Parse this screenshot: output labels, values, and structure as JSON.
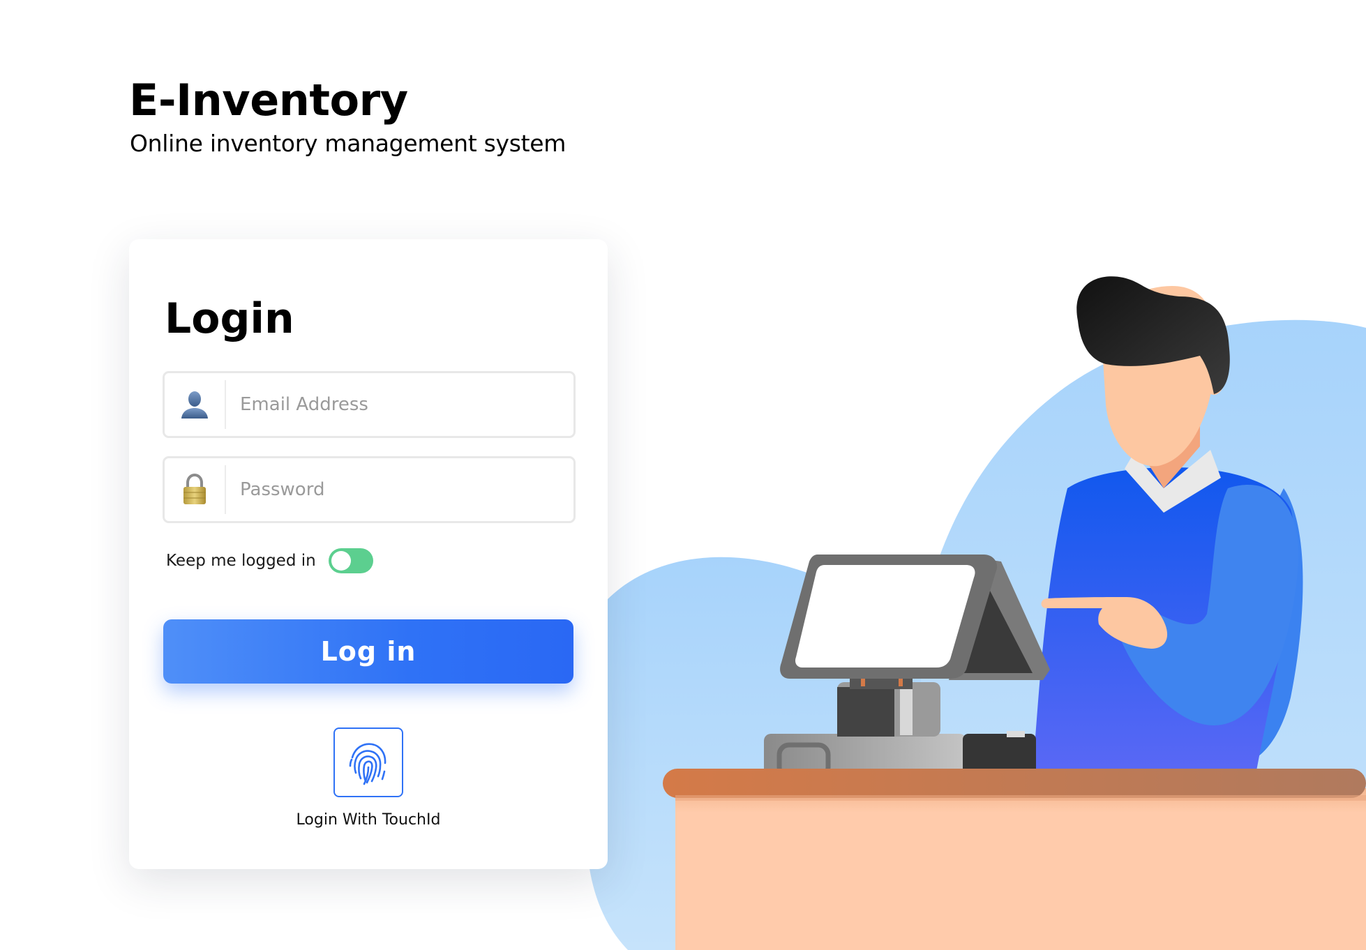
{
  "brand": {
    "title": "E-Inventory",
    "subtitle": "Online inventory management system"
  },
  "login": {
    "heading": "Login",
    "email": {
      "placeholder": "Email Address",
      "value": "",
      "icon": "user-icon"
    },
    "password": {
      "placeholder": "Password",
      "value": "",
      "icon": "lock-icon"
    },
    "keep_logged_in": {
      "label": "Keep me logged in",
      "enabled": true
    },
    "submit_label": "Log in",
    "touch_id": {
      "label": "Login With TouchId",
      "icon": "fingerprint-icon"
    }
  },
  "colors": {
    "primary": "#2f72f6",
    "toggle_on": "#5ccf8f",
    "background_blob": "#a8d3fa",
    "counter_top": "#cd7a4c",
    "counter_body": "#ffcbab",
    "shirt": "#1a62f0"
  }
}
